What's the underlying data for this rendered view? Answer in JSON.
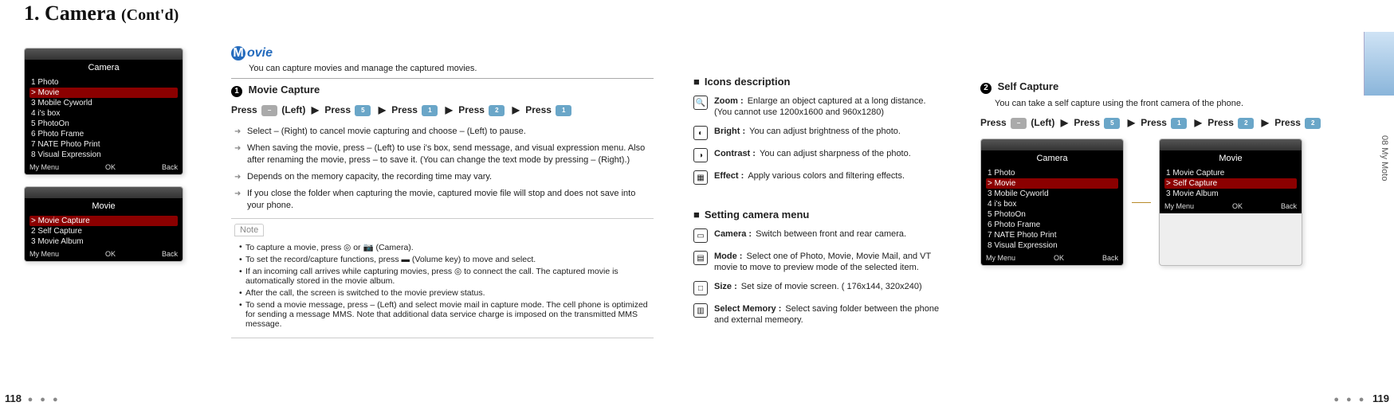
{
  "page": {
    "title_num": "1.",
    "title": "Camera",
    "title_contd": "(Cont'd)",
    "leftPage": "118",
    "rightPage": "119",
    "sideLabel": "08  My Moto",
    "dots": "● ● ●"
  },
  "shot_camera": {
    "title": "Camera",
    "items": [
      "1  Photo",
      "2  Movie",
      "3  Mobile Cyworld",
      "4  i's box",
      "5  PhotoOn",
      "6  Photo Frame",
      "7  NATE Photo Print",
      "8  Visual Expression"
    ],
    "selectedIndex": 1,
    "footL": "My Menu",
    "footC": "OK",
    "footR": "Back"
  },
  "shot_movie": {
    "title": "Movie",
    "items": [
      "1  Movie Capture",
      "2  Self Capture",
      "3  Movie Album"
    ],
    "selectedIndex": 0,
    "footL": "My Menu",
    "footC": "OK",
    "footR": "Back"
  },
  "movie": {
    "header_letter": "M",
    "header": "ovie",
    "sub": "You can capture movies and manage the captured movies.",
    "capture": {
      "num": "1",
      "title": "Movie Capture",
      "press": {
        "p1": "Press",
        "k1": "–",
        "k1b": "(Left)",
        "arr": "▶",
        "p2": "Press",
        "k2": "5",
        "p3": "Press",
        "k3": "1",
        "p4": "Press",
        "k4": "2",
        "p5": "Press",
        "k5": "1"
      },
      "bullets": [
        "Select – (Right) to cancel movie capturing and choose – (Left) to pause.",
        "When saving the movie, press – (Left) to use i's box, send message, and visual expression menu. Also after renaming the movie, press – to save it. (You can change the text mode by pressing – (Right).)",
        "Depends on the memory capacity, the recording time may vary.",
        "If you close the folder when capturing the movie, captured movie file will stop and does not save into your phone."
      ],
      "note_label": "Note",
      "notes": [
        "To capture a movie, press ◎ or  📷 (Camera).",
        "To set the record/capture functions, press ▬ (Volume key) to move and select.",
        "If an incoming call arrives while capturing movies, press ◎ to connect the call. The captured movie is automatically stored in the movie album.",
        "After the call, the screen is switched to the movie preview status.",
        "To send a movie message, press – (Left) and select movie mail in capture mode.\nThe cell phone is optimized for sending a message MMS. Note that additional data service charge is imposed on the transmitted MMS message."
      ]
    }
  },
  "icons": {
    "heading": "Icons description",
    "rows": [
      {
        "icon": "🔍",
        "label": "Zoom :",
        "text": "Enlarge an object captured at a long distance.\n(You cannot use 1200x1600 and 960x1280)"
      },
      {
        "icon": "◐",
        "label": "Bright :",
        "text": "You can adjust brightness of the photo."
      },
      {
        "icon": "◑",
        "label": "Contrast :",
        "text": "You can adjust sharpness of the photo."
      },
      {
        "icon": "▦",
        "label": "Effect :",
        "text": "Apply various colors and filtering effects."
      }
    ]
  },
  "settings": {
    "heading": "Setting camera menu",
    "rows": [
      {
        "icon": "▭",
        "label": "Camera :",
        "text": "Switch between front and rear camera."
      },
      {
        "icon": "▤",
        "label": "Mode :",
        "text": "Select one of Photo, Movie, Movie Mail, and VT movie to move to preview mode of the selected item."
      },
      {
        "icon": "□",
        "label": "Size :",
        "text": "Set size of movie screen. ( 176x144, 320x240)"
      },
      {
        "icon": "▥",
        "label": "Select Memory :",
        "text": "Select saving folder between the phone and external memeory."
      }
    ]
  },
  "self": {
    "num": "2",
    "title": "Self Capture",
    "sub": "You can take a self capture using the front camera of the phone.",
    "press": {
      "p1": "Press",
      "k1": "–",
      "k1b": "(Left)",
      "arr": "▶",
      "p2": "Press",
      "k2": "5",
      "p3": "Press",
      "k3": "1",
      "p4": "Press",
      "k4": "2",
      "p5": "Press",
      "k5": "2"
    }
  },
  "shot_camera2": {
    "title": "Camera",
    "items": [
      "1  Photo",
      "2  Movie",
      "3  Mobile Cyworld",
      "4  i's box",
      "5  PhotoOn",
      "6  Photo Frame",
      "7  NATE Photo Print",
      "8  Visual Expression"
    ],
    "selectedIndex": 1,
    "footL": "My Menu",
    "footC": "OK",
    "footR": "Back"
  },
  "shot_movie2": {
    "title": "Movie",
    "items": [
      "1  Movie Capture",
      "2  Self Capture",
      "3  Movie Album"
    ],
    "selectedIndex": 1,
    "footL": "My Menu",
    "footC": "OK",
    "footR": "Back"
  }
}
